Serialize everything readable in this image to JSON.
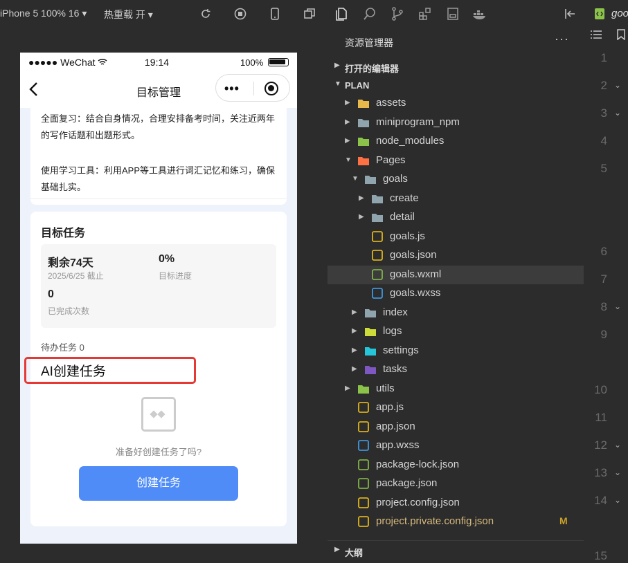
{
  "simulator": {
    "device_label": "iPhone 5 100% 16 ▾",
    "hot_reload_label": "热重载 开 ▾"
  },
  "phone": {
    "status": {
      "carrier": "●●●●● WeChat",
      "time": "19:14",
      "battery": "100%"
    },
    "nav_title": "目标管理",
    "capsule_dots": "•••",
    "para1": "全面复习：结合自身情况，合理安排备考时间，关注近两年的写作话题和出题形式。",
    "para2": "使用学习工具：利用APP等工具进行词汇记忆和练习，确保基础扎实。",
    "section_title": "目标任务",
    "stats": [
      {
        "value": "剩余74天",
        "label": "2025/6/25 截止"
      },
      {
        "value": "0%",
        "label": "目标进度"
      },
      {
        "value": "0",
        "label": "已完成次数"
      }
    ],
    "todo_label": "待办任务 0",
    "ai_title": "AI创建任务",
    "empty_prompt": "准备好创建任务了吗?",
    "create_button": "创建任务"
  },
  "explorer": {
    "title": "资源管理器",
    "more": "···",
    "open_editors": "打开的编辑器",
    "project": "PLAN",
    "outline": "大纲",
    "items": [
      {
        "name": "assets",
        "icon": "folder-assets-icon",
        "color": "#e8b84a"
      },
      {
        "name": "miniprogram_npm",
        "icon": "folder-icon",
        "color": "#90a4ae"
      },
      {
        "name": "node_modules",
        "icon": "folder-node-icon",
        "color": "#8bc34a"
      },
      {
        "name": "Pages",
        "icon": "folder-pages-icon",
        "color": "#ff7043"
      },
      {
        "name": "goals",
        "icon": "folder-open-icon",
        "color": "#90a4ae"
      },
      {
        "name": "create",
        "icon": "folder-icon",
        "color": "#90a4ae"
      },
      {
        "name": "detail",
        "icon": "folder-icon",
        "color": "#90a4ae"
      },
      {
        "name": "goals.js",
        "icon": "js-file-icon",
        "color": "#f5c518"
      },
      {
        "name": "goals.json",
        "icon": "json-file-icon",
        "color": "#f5c518"
      },
      {
        "name": "goals.wxml",
        "icon": "wxml-file-icon",
        "color": "#8bc34a"
      },
      {
        "name": "goals.wxss",
        "icon": "css-file-icon",
        "color": "#42a5f5"
      },
      {
        "name": "index",
        "icon": "folder-icon",
        "color": "#90a4ae"
      },
      {
        "name": "logs",
        "icon": "folder-logs-icon",
        "color": "#cddc39"
      },
      {
        "name": "settings",
        "icon": "folder-settings-icon",
        "color": "#26c6da"
      },
      {
        "name": "tasks",
        "icon": "folder-tasks-icon",
        "color": "#7e57c2"
      },
      {
        "name": "utils",
        "icon": "folder-utils-icon",
        "color": "#8bc34a"
      },
      {
        "name": "app.js",
        "icon": "js-file-icon",
        "color": "#f5c518"
      },
      {
        "name": "app.json",
        "icon": "json-file-icon",
        "color": "#f5c518"
      },
      {
        "name": "app.wxss",
        "icon": "css-file-icon",
        "color": "#42a5f5"
      },
      {
        "name": "package-lock.json",
        "icon": "node-file-icon",
        "color": "#8bc34a"
      },
      {
        "name": "package.json",
        "icon": "node-file-icon",
        "color": "#8bc34a"
      },
      {
        "name": "project.config.json",
        "icon": "json-file-icon",
        "color": "#f5c518"
      },
      {
        "name": "project.private.config.json",
        "icon": "json-file-icon",
        "color": "#f5c518",
        "modified": "M"
      }
    ]
  },
  "editor": {
    "tab_name": "goo",
    "line_numbers": [
      "1",
      "2",
      "3",
      "4",
      "5",
      "6",
      "7",
      "8",
      "9",
      "10",
      "11",
      "12",
      "13",
      "14",
      "15"
    ]
  }
}
